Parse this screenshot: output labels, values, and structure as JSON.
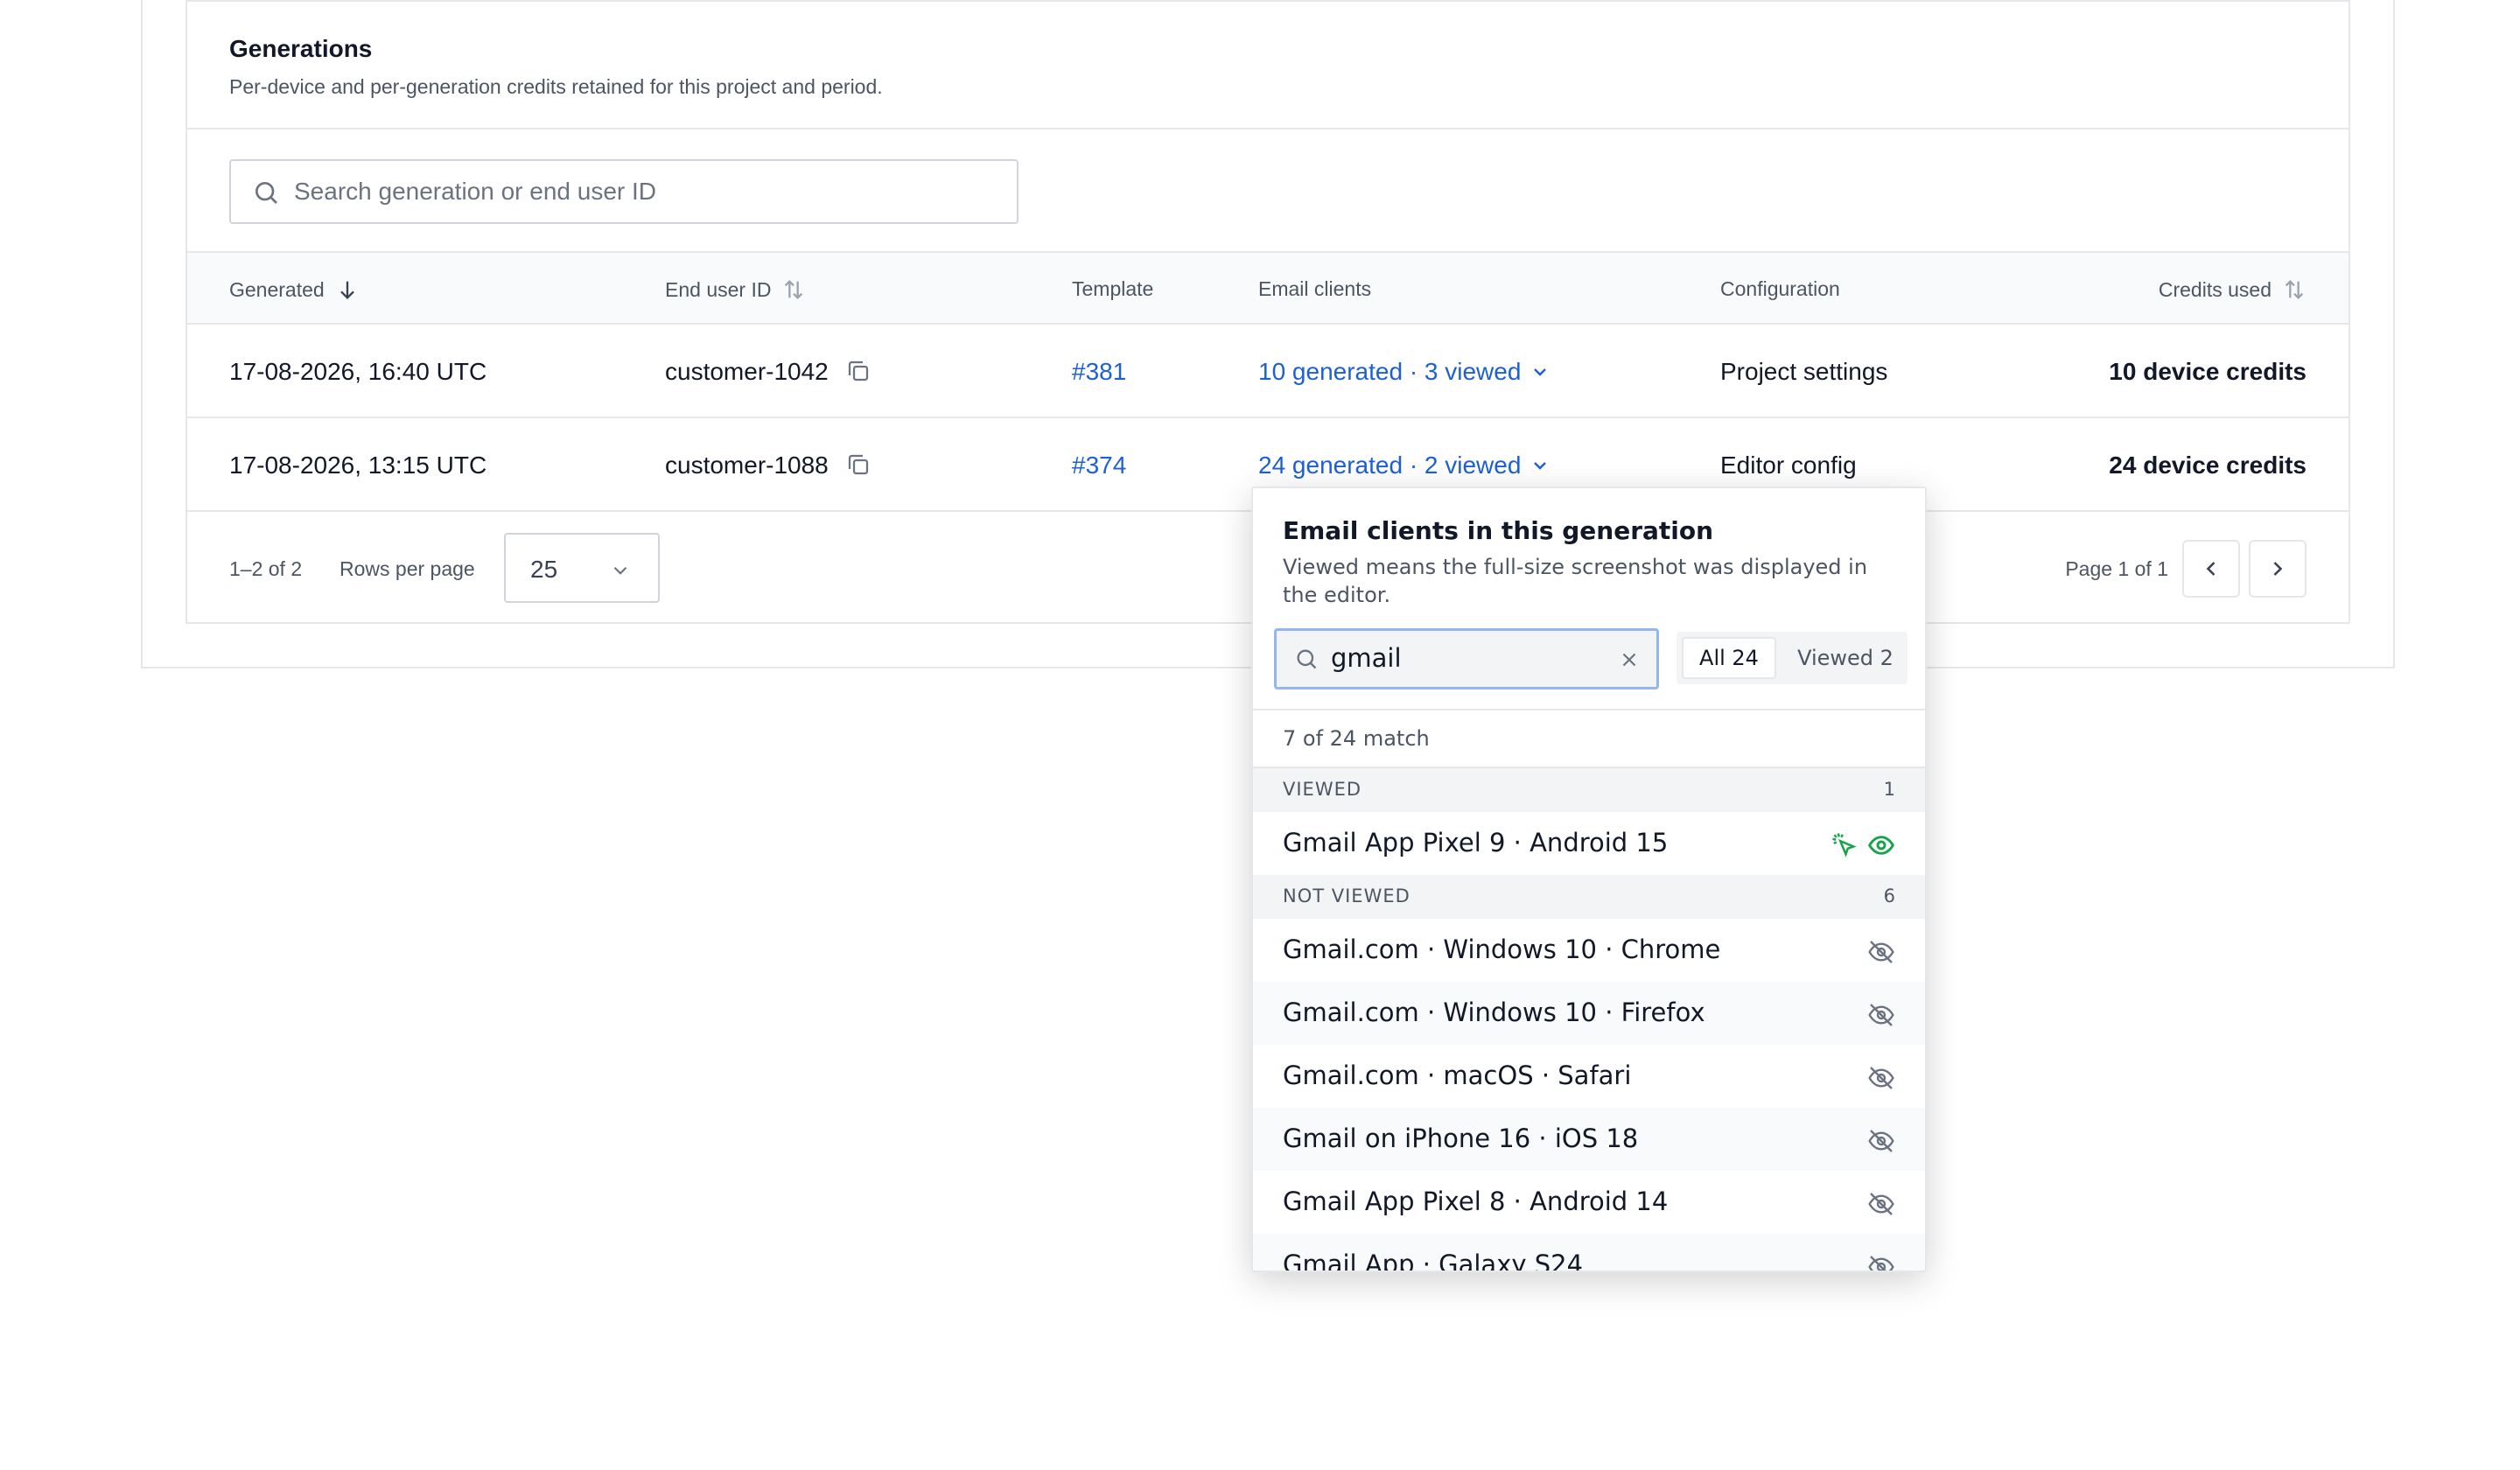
{
  "generations": {
    "title": "Generations",
    "subtitle": "Per-device and per-generation credits retained for this project and period.",
    "search_placeholder": "Search generation or end user ID",
    "columns": {
      "generated": "Generated",
      "end_user_id": "End user ID",
      "template": "Template",
      "email_clients": "Email clients",
      "configuration": "Configuration",
      "credits_used": "Credits used"
    },
    "rows": [
      {
        "generated": "17-08-2026, 16:40 UTC",
        "end_user_id": "customer-1042",
        "template": "#381",
        "email_clients": "10 generated · 3 viewed",
        "configuration": "Project settings",
        "credits": "10 device credits"
      },
      {
        "generated": "17-08-2026, 13:15 UTC",
        "end_user_id": "customer-1088",
        "template": "#374",
        "email_clients": "24 generated · 2 viewed",
        "configuration": "Editor config",
        "credits": "24 device credits"
      }
    ],
    "footer": {
      "range": "1–2 of 2",
      "rows_per_page_label": "Rows per page",
      "rows_per_page_value": "25",
      "page": "Page 1 of 1"
    }
  },
  "popover": {
    "title": "Email clients in this generation",
    "subtitle": "Viewed means the full-size screenshot was displayed in the editor.",
    "search_value": "gmail",
    "filter_all": "All 24",
    "filter_viewed": "Viewed 2",
    "match_text": "7 of 24 match",
    "viewed_section": {
      "label": "VIEWED",
      "count": "1"
    },
    "viewed_items": [
      "Gmail App Pixel 9 · Android 15"
    ],
    "not_viewed_section": {
      "label": "NOT VIEWED",
      "count": "6"
    },
    "not_viewed_items": [
      "Gmail.com · Windows 10 · Chrome",
      "Gmail.com · Windows 10 · Firefox",
      "Gmail.com · macOS · Safari",
      "Gmail on iPhone 16 · iOS 18",
      "Gmail App Pixel 8 · Android 14",
      "Gmail App · Galaxy S24"
    ]
  },
  "colors": {
    "link": "#1d5fd6",
    "viewed_green": "#16a34a",
    "border": "#e5e7eb",
    "focus_ring": "#93b6f0"
  }
}
